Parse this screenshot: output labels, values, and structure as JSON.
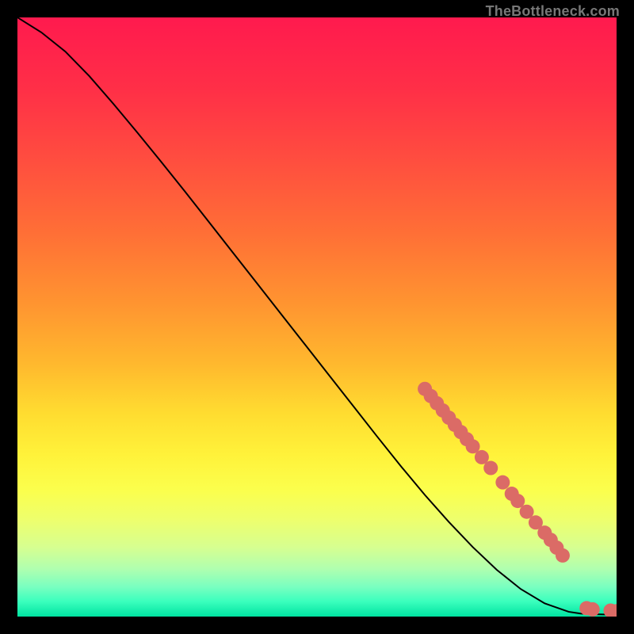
{
  "watermark": "TheBottleneck.com",
  "chart_data": {
    "type": "line",
    "title": "",
    "xlabel": "",
    "ylabel": "",
    "xlim": [
      0,
      100
    ],
    "ylim": [
      0,
      100
    ],
    "grid": false,
    "legend": false,
    "series": [
      {
        "name": "curve",
        "kind": "line",
        "color": "#000000",
        "x": [
          0,
          4,
          8,
          12,
          16,
          20,
          24,
          28,
          32,
          36,
          40,
          44,
          48,
          52,
          56,
          60,
          64,
          68,
          72,
          76,
          80,
          84,
          88,
          92,
          94,
          96,
          98,
          100
        ],
        "y": [
          100,
          97.5,
          94.3,
          90.2,
          85.6,
          80.8,
          75.9,
          70.9,
          65.8,
          60.7,
          55.6,
          50.5,
          45.4,
          40.3,
          35.2,
          30.1,
          25.1,
          20.3,
          15.8,
          11.6,
          7.8,
          4.6,
          2.2,
          0.8,
          0.5,
          0.4,
          0.35,
          0.35
        ]
      },
      {
        "name": "markers",
        "kind": "scatter",
        "color": "#db6b66",
        "x": [
          68,
          69,
          70,
          71,
          72,
          73,
          74,
          75,
          76,
          77.5,
          79,
          81,
          82.5,
          83.5,
          85,
          86.5,
          88,
          89,
          90,
          91,
          95,
          96,
          99,
          100
        ],
        "y": [
          38.0,
          36.8,
          35.6,
          34.4,
          33.2,
          32.0,
          30.8,
          29.6,
          28.4,
          26.6,
          24.8,
          22.4,
          20.5,
          19.3,
          17.5,
          15.7,
          14.0,
          12.8,
          11.5,
          10.2,
          1.4,
          1.2,
          1.0,
          0.9
        ]
      }
    ],
    "background_gradient": {
      "stops": [
        {
          "offset": 0.0,
          "color": "#ff1a4e"
        },
        {
          "offset": 0.12,
          "color": "#ff2f47"
        },
        {
          "offset": 0.24,
          "color": "#ff4e3f"
        },
        {
          "offset": 0.36,
          "color": "#ff6f36"
        },
        {
          "offset": 0.48,
          "color": "#ff9530"
        },
        {
          "offset": 0.58,
          "color": "#ffb92e"
        },
        {
          "offset": 0.66,
          "color": "#ffdc30"
        },
        {
          "offset": 0.73,
          "color": "#fff23a"
        },
        {
          "offset": 0.79,
          "color": "#fbff4d"
        },
        {
          "offset": 0.84,
          "color": "#edff6e"
        },
        {
          "offset": 0.885,
          "color": "#d6ff91"
        },
        {
          "offset": 0.92,
          "color": "#b0ffaf"
        },
        {
          "offset": 0.95,
          "color": "#7affc0"
        },
        {
          "offset": 0.975,
          "color": "#3affbd"
        },
        {
          "offset": 1.0,
          "color": "#00e3a1"
        }
      ]
    }
  }
}
